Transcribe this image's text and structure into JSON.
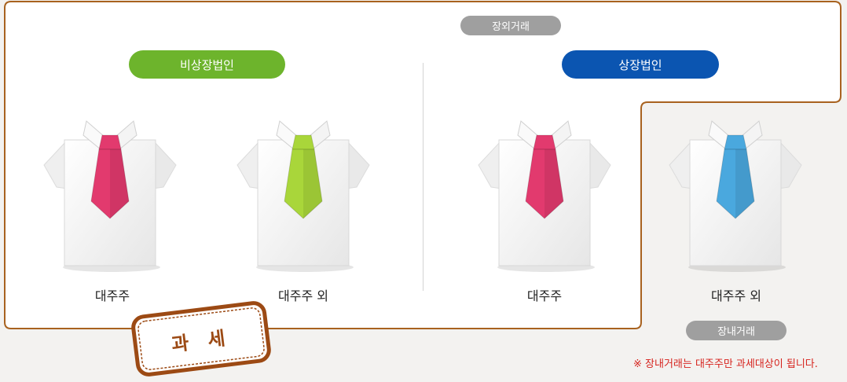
{
  "labels": {
    "off_market": "장외거래",
    "non_listed_corp": "비상장법인",
    "listed_corp": "상장법인",
    "on_market": "장내거래",
    "taxation_stamp": "과 세",
    "note": "※ 장내거래는 대주주만 과세대상이 됩니다."
  },
  "shirts": [
    {
      "caption": "대주주",
      "tie_color": "#e23a6e"
    },
    {
      "caption": "대주주 외",
      "tie_color": "#a9d63a"
    },
    {
      "caption": "대주주",
      "tie_color": "#e23a6e"
    },
    {
      "caption": "대주주 외",
      "tie_color": "#4aa8de"
    }
  ],
  "colors": {
    "frame_border": "#a8621f",
    "green_pill": "#6db42c",
    "blue_pill": "#0b55b1",
    "gray_pill": "#9f9f9f",
    "note_red": "#d6221c"
  }
}
